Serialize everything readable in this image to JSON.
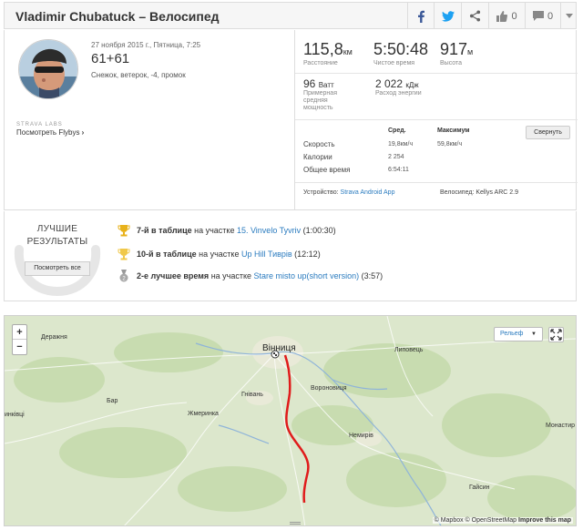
{
  "header": {
    "title": "Vladimir Chubatuck – Велосипед",
    "kudos_count": "0",
    "comments_count": "0"
  },
  "activity": {
    "date": "27 ноября 2015 г., Пятница, 7:25",
    "name": "61+61",
    "weather": "Снежок, ветерок, -4, промок"
  },
  "labs": {
    "title": "STRAVA LABS",
    "flybys": "Посмотреть Flybys"
  },
  "stats": {
    "distance_value": "115,8",
    "distance_unit": "км",
    "distance_label": "Расстояние",
    "moving_time_value": "5:50:48",
    "moving_time_label": "Чистое время",
    "elevation_value": "917",
    "elevation_unit": "м",
    "elevation_label": "Высота",
    "power_value": "96",
    "power_unit": "Ватт",
    "power_label_1": "Примерная",
    "power_label_2": "средняя",
    "power_label_3": "мощность",
    "energy_value": "2 022",
    "energy_unit": "кДж",
    "energy_label": "Расход энергии"
  },
  "detail_table": {
    "col_avg": "Сред.",
    "col_max": "Максимум",
    "collapse_label": "Свернуть",
    "rows": [
      {
        "label": "Скорость",
        "avg": "19,8км/ч",
        "max": "59,8км/ч"
      },
      {
        "label": "Калории",
        "avg": "2 254",
        "max": ""
      },
      {
        "label": "Общее время",
        "avg": "6:54:11",
        "max": ""
      }
    ]
  },
  "device": {
    "device_label": "Устройство:",
    "device_value": "Strava Android App",
    "bike_label": "Велосипед:",
    "bike_value": "Kellys ARC 2.9"
  },
  "achievements": {
    "title_line1": "ЛУЧШИЕ",
    "title_line2": "РЕЗУЛЬТАТЫ",
    "see_all": "Посмотреть все",
    "items": [
      {
        "rank": "7-й в таблице",
        "mid": " на участке ",
        "segment": "15. Vinvelo Tyvriv",
        "time": " (1:00:30)",
        "icon": "trophy-gold-icon"
      },
      {
        "rank": "10-й в таблице",
        "mid": " на участке ",
        "segment": "Up Hill Тиврів",
        "time": " (12:12)",
        "icon": "trophy-gold-10-icon"
      },
      {
        "rank": "2-е лучшее время",
        "mid": " на участке ",
        "segment": "Stare misto up(short version)",
        "time": " (3:57)",
        "icon": "medal-silver-icon"
      }
    ]
  },
  "map": {
    "zoom_in": "+",
    "zoom_out": "−",
    "layer_select": "Рельеф",
    "attribution": "© Mapbox © OpenStreetMap",
    "improve": "Improve this map",
    "places": {
      "vinnytsia": "Вінниця",
      "derazhnya": "Деражня",
      "lypovets": "Липовець",
      "bar": "Бар",
      "hnivan": "Гнівань",
      "voronovytsia": "Вороновиця",
      "zhmerynka": "Жмеринка",
      "nemyriv": "Немирів",
      "monastyr": "Монастир",
      "hayisyn": "Гайсин",
      "kivtsi": "инківці"
    }
  },
  "colors": {
    "accent": "#2a7bbf",
    "route": "#e01b1b",
    "facebook": "#3b5998",
    "twitter": "#1da1f2"
  }
}
